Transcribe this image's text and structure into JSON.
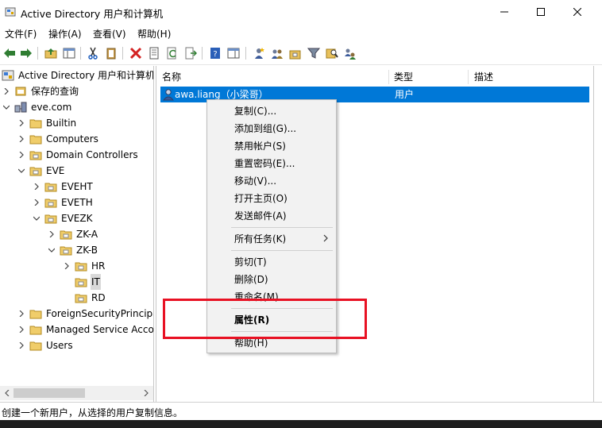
{
  "window": {
    "title": "Active Directory 用户和计算机"
  },
  "menu": [
    "文件(F)",
    "操作(A)",
    "查看(V)",
    "帮助(H)"
  ],
  "tree": {
    "root": "Active Directory 用户和计算机",
    "items": [
      {
        "label": "保存的查询",
        "depth": 1,
        "expander": ">",
        "icon": "saved-query-icon"
      },
      {
        "label": "eve.com",
        "depth": 1,
        "expander": "v",
        "icon": "domain-icon"
      },
      {
        "label": "Builtin",
        "depth": 2,
        "expander": ">",
        "icon": "folder-icon"
      },
      {
        "label": "Computers",
        "depth": 2,
        "expander": ">",
        "icon": "folder-icon"
      },
      {
        "label": "Domain Controllers",
        "depth": 2,
        "expander": ">",
        "icon": "ou-folder-icon"
      },
      {
        "label": "EVE",
        "depth": 2,
        "expander": "v",
        "icon": "ou-folder-icon"
      },
      {
        "label": "EVEHT",
        "depth": 3,
        "expander": ">",
        "icon": "ou-folder-icon"
      },
      {
        "label": "EVETH",
        "depth": 3,
        "expander": ">",
        "icon": "ou-folder-icon"
      },
      {
        "label": "EVEZK",
        "depth": 3,
        "expander": "v",
        "icon": "ou-folder-icon"
      },
      {
        "label": "ZK-A",
        "depth": 4,
        "expander": ">",
        "icon": "ou-folder-icon"
      },
      {
        "label": "ZK-B",
        "depth": 4,
        "expander": "v",
        "icon": "ou-folder-icon"
      },
      {
        "label": "HR",
        "depth": 5,
        "expander": ">",
        "icon": "ou-folder-icon"
      },
      {
        "label": "IT",
        "depth": 5,
        "expander": "",
        "icon": "ou-folder-icon",
        "selected": true
      },
      {
        "label": "RD",
        "depth": 5,
        "expander": "",
        "icon": "ou-folder-icon"
      },
      {
        "label": "ForeignSecurityPrincipals",
        "depth": 2,
        "expander": ">",
        "icon": "folder-icon"
      },
      {
        "label": "Managed Service Accounts",
        "depth": 2,
        "expander": ">",
        "icon": "folder-icon"
      },
      {
        "label": "Users",
        "depth": 2,
        "expander": ">",
        "icon": "folder-icon"
      }
    ]
  },
  "list": {
    "columns": [
      "名称",
      "类型",
      "描述"
    ],
    "rows": [
      {
        "name": "awa.liang（小梁哥）",
        "type": "用户",
        "description": ""
      }
    ]
  },
  "context_menu": {
    "items": [
      {
        "label": "复制(C)..."
      },
      {
        "label": "添加到组(G)..."
      },
      {
        "label": "禁用帐户(S)"
      },
      {
        "label": "重置密码(E)..."
      },
      {
        "label": "移动(V)..."
      },
      {
        "label": "打开主页(O)"
      },
      {
        "label": "发送邮件(A)"
      },
      {
        "separator": true
      },
      {
        "label": "所有任务(K)",
        "submenu": true
      },
      {
        "separator": true
      },
      {
        "label": "剪切(T)"
      },
      {
        "label": "删除(D)"
      },
      {
        "label": "重命名(M)"
      },
      {
        "separator": true
      },
      {
        "label": "属性(R)",
        "bold": true
      },
      {
        "separator": true
      },
      {
        "label": "帮助(H)"
      }
    ]
  },
  "status": {
    "text": "创建一个新用户，从选择的用户复制信息。"
  },
  "colors": {
    "selection": "#0078d7",
    "highlight_box": "#e81123"
  }
}
